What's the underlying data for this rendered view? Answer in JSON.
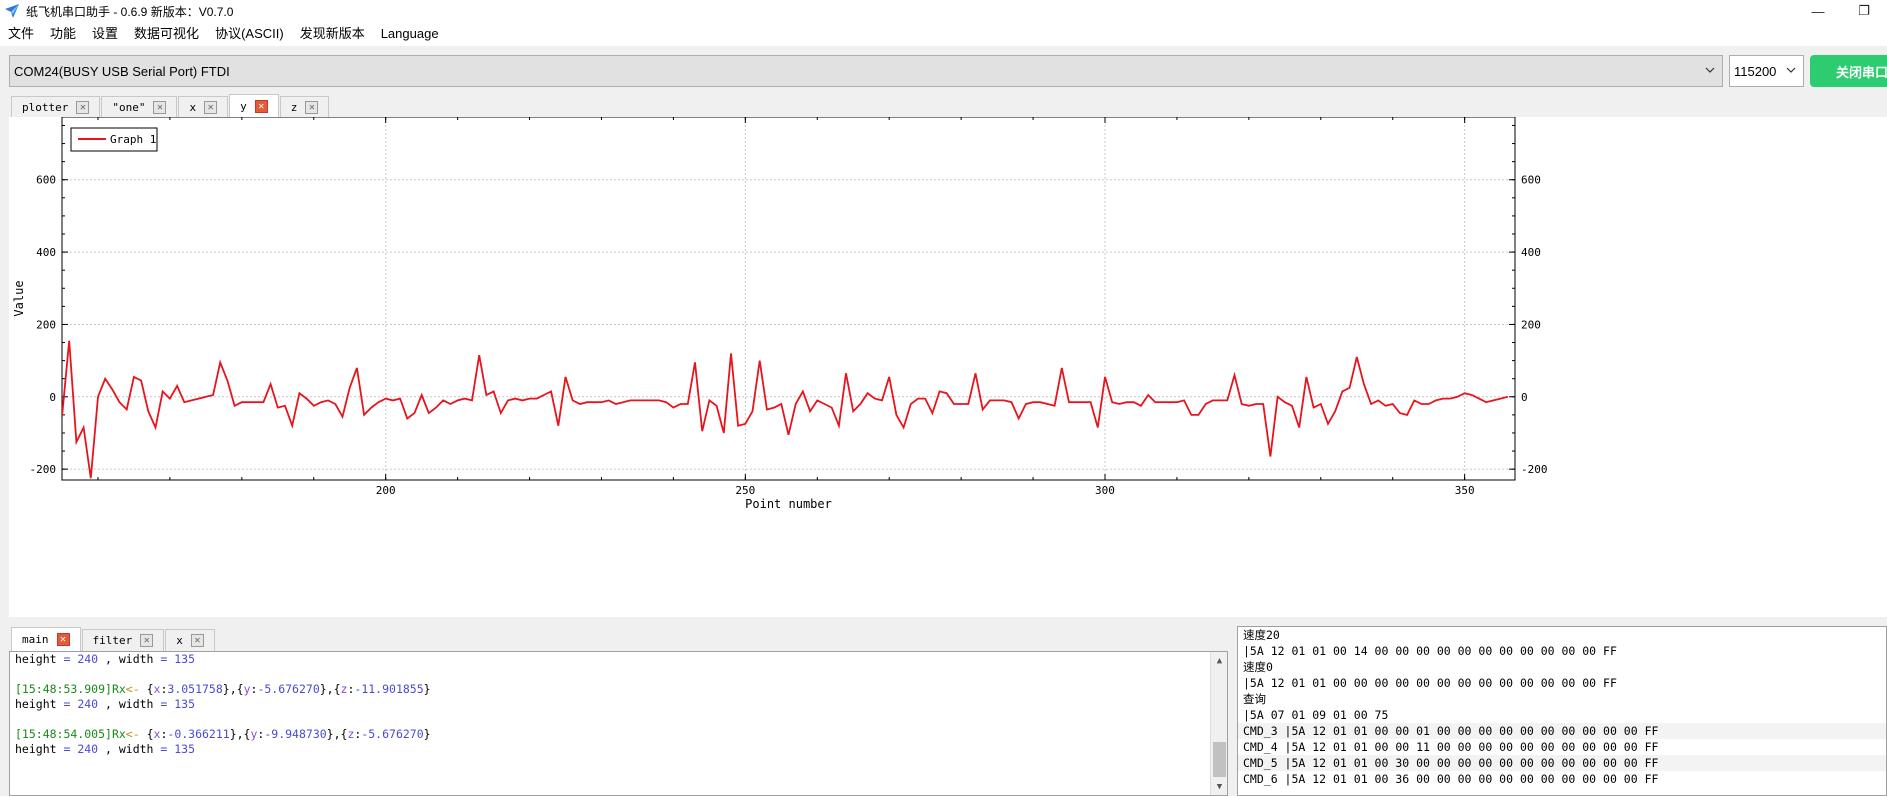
{
  "window": {
    "title": "纸飞机串口助手 - 0.6.9 新版本：V0.7.0",
    "minimize": "—",
    "restore": "❐"
  },
  "menu": [
    "文件",
    "功能",
    "设置",
    "数据可视化",
    "协议(ASCII)",
    "发现新版本",
    "Language"
  ],
  "toolbar": {
    "port": "COM24(BUSY  USB Serial Port) FTDI",
    "baud": "115200",
    "close_port": "关闭串口"
  },
  "plot_tabs": [
    {
      "label": "plotter",
      "active": false
    },
    {
      "label": "\"one\"",
      "active": false
    },
    {
      "label": "x",
      "active": false
    },
    {
      "label": "y",
      "active": true
    },
    {
      "label": "z",
      "active": false
    }
  ],
  "console_tabs": [
    {
      "label": "main",
      "active": true
    },
    {
      "label": "filter",
      "active": false
    },
    {
      "label": "x",
      "active": false
    }
  ],
  "colors": {
    "line": "#e8141c",
    "accent_green": "#2ecc71",
    "tab_close_active": "#e25b3a"
  },
  "chart_data": {
    "type": "line",
    "title": "",
    "xlabel": "Point number",
    "ylabel": "Value",
    "xlim": [
      155,
      357
    ],
    "ylim": [
      -230,
      790
    ],
    "x_ticks": [
      200,
      250,
      300,
      350
    ],
    "y_ticks": [
      -200,
      0,
      200,
      400,
      600
    ],
    "grid": true,
    "legend": "top-left",
    "series": [
      {
        "name": "Graph 1",
        "x_start": 155,
        "values": [
          -55,
          155,
          -125,
          -85,
          -225,
          0,
          50,
          20,
          -15,
          -35,
          55,
          45,
          -40,
          -85,
          15,
          -5,
          30,
          -15,
          -10,
          -5,
          0,
          5,
          95,
          45,
          -25,
          -15,
          -15,
          -15,
          -15,
          35,
          -30,
          -25,
          -80,
          10,
          -5,
          -25,
          -15,
          -10,
          -20,
          -55,
          25,
          80,
          -50,
          -30,
          -15,
          -5,
          -10,
          -5,
          -60,
          -45,
          5,
          -45,
          -30,
          -10,
          -20,
          -10,
          -5,
          -10,
          115,
          5,
          15,
          -45,
          -10,
          -5,
          -10,
          -5,
          -5,
          5,
          15,
          -80,
          55,
          -10,
          -20,
          -15,
          -15,
          -15,
          -10,
          -20,
          -15,
          -10,
          -10,
          -10,
          -10,
          -10,
          -15,
          -30,
          -20,
          -20,
          95,
          -95,
          -10,
          -25,
          -100,
          120,
          -80,
          -75,
          -40,
          100,
          -35,
          -30,
          -20,
          -105,
          -20,
          15,
          -40,
          -10,
          -20,
          -30,
          -80,
          65,
          -40,
          -20,
          10,
          -5,
          -10,
          55,
          -50,
          -85,
          -20,
          -5,
          -5,
          -45,
          15,
          10,
          -20,
          -20,
          -20,
          65,
          -35,
          -10,
          -10,
          -10,
          -15,
          -60,
          -20,
          -15,
          -15,
          -20,
          -25,
          80,
          -15,
          -15,
          -15,
          -15,
          -85,
          55,
          -15,
          -20,
          -15,
          -15,
          -25,
          5,
          -15,
          -15,
          -15,
          -15,
          -10,
          -50,
          -50,
          -20,
          -10,
          -10,
          -10,
          60,
          -20,
          -25,
          -20,
          -20,
          -165,
          0,
          -15,
          -25,
          -85,
          55,
          -30,
          -20,
          -75,
          -40,
          15,
          25,
          110,
          35,
          -20,
          -10,
          -25,
          -20,
          -45,
          -50,
          -10,
          -20,
          -20,
          -10,
          -5,
          -5,
          0,
          10,
          5,
          -5,
          -15,
          -10,
          -5,
          0
        ]
      }
    ]
  },
  "console": [
    {
      "parts": [
        [
          "c-plain",
          "height "
        ],
        [
          "c-blue",
          "= 240"
        ],
        [
          "c-plain",
          " , width "
        ],
        [
          "c-blue",
          "= 135"
        ]
      ]
    },
    {
      "parts": [
        [
          "c-plain",
          ""
        ]
      ]
    },
    {
      "parts": [
        [
          "c-green",
          "[15:48:53.909]"
        ],
        [
          "c-green",
          "Rx"
        ],
        [
          "c-orange",
          "<- "
        ],
        [
          "c-plain",
          "{"
        ],
        [
          "c-purple",
          "x"
        ],
        [
          "c-plain",
          ":"
        ],
        [
          "c-blue",
          "3.051758"
        ],
        [
          "c-plain",
          "},{"
        ],
        [
          "c-purple",
          "y"
        ],
        [
          "c-plain",
          ":"
        ],
        [
          "c-blue",
          "-5.676270"
        ],
        [
          "c-plain",
          "},{"
        ],
        [
          "c-purple",
          "z"
        ],
        [
          "c-plain",
          ":"
        ],
        [
          "c-blue",
          "-11.901855"
        ],
        [
          "c-plain",
          "}"
        ]
      ]
    },
    {
      "parts": [
        [
          "c-plain",
          "height "
        ],
        [
          "c-blue",
          "= 240"
        ],
        [
          "c-plain",
          " , width "
        ],
        [
          "c-blue",
          "= 135"
        ]
      ]
    },
    {
      "parts": [
        [
          "c-plain",
          ""
        ]
      ]
    },
    {
      "parts": [
        [
          "c-green",
          "[15:48:54.005]"
        ],
        [
          "c-green",
          "Rx"
        ],
        [
          "c-orange",
          "<- "
        ],
        [
          "c-plain",
          "{"
        ],
        [
          "c-purple",
          "x"
        ],
        [
          "c-plain",
          ":"
        ],
        [
          "c-blue",
          "-0.366211"
        ],
        [
          "c-plain",
          "},{"
        ],
        [
          "c-purple",
          "y"
        ],
        [
          "c-plain",
          ":"
        ],
        [
          "c-blue",
          "-9.948730"
        ],
        [
          "c-plain",
          "},{"
        ],
        [
          "c-purple",
          "z"
        ],
        [
          "c-plain",
          ":"
        ],
        [
          "c-blue",
          "-5.676270"
        ],
        [
          "c-plain",
          "}"
        ]
      ]
    },
    {
      "parts": [
        [
          "c-plain",
          "height "
        ],
        [
          "c-blue",
          "= 240"
        ],
        [
          "c-plain",
          " , width "
        ],
        [
          "c-blue",
          "= 135"
        ]
      ]
    }
  ],
  "commands": [
    "速度20",
    "|5A 12 01 01 00 14 00 00 00 00 00 00 00 00 00 00 00 FF",
    "速度0",
    "|5A 12 01 01 00 00 00 00 00 00 00 00 00 00 00 00 00 FF",
    "查询",
    "|5A 07 01 09 01 00 75",
    "CMD_3 |5A 12 01 01 00 00 01 00 00 00 00 00 00 00 00 00 00 FF",
    "CMD_4 |5A 12 01 01 00 00 11 00 00 00 00 00 00 00 00 00 00 FF",
    "CMD_5 |5A 12 01 01 00 30 00 00 00 00 00 00 00 00 00 00 00 FF",
    "CMD_6 |5A 12 01 01 00 36 00 00 00 00 00 00 00 00 00 00 00 FF"
  ]
}
